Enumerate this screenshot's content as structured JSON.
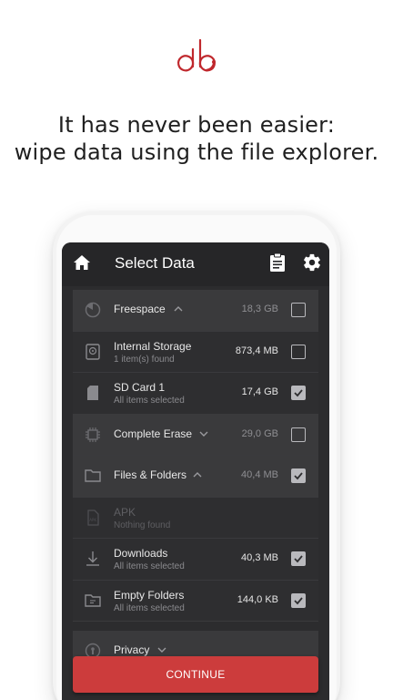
{
  "headline": {
    "line1": "It has never been easier:",
    "line2": "wipe data using the file explorer."
  },
  "colors": {
    "brand": "#c0282d",
    "button": "#cc3c3c",
    "screen": "#2c2c2e"
  },
  "appbar": {
    "title": "Select Data",
    "icons": [
      "home-icon",
      "clipboard-icon",
      "gear-icon"
    ]
  },
  "rows": [
    {
      "kind": "group",
      "icon": "pie-chart-icon",
      "name": "Freespace",
      "chevron": "up",
      "size": "18,3 GB",
      "checked": false
    },
    {
      "kind": "item",
      "icon": "internal-storage-icon",
      "name": "Internal Storage",
      "sub": "1 item(s) found",
      "size": "873,4 MB",
      "checked": false
    },
    {
      "kind": "item",
      "icon": "sd-card-icon",
      "name": "SD Card 1",
      "sub": "All items selected",
      "size": "17,4 GB",
      "checked": true
    },
    {
      "kind": "group",
      "icon": "chip-icon",
      "name": "Complete Erase",
      "chevron": "down",
      "size": "29,0 GB",
      "checked": false
    },
    {
      "kind": "group",
      "icon": "folder-icon",
      "name": "Files & Folders",
      "chevron": "up",
      "size": "40,4 MB",
      "checked": true
    },
    {
      "kind": "item",
      "icon": "apk-file-icon",
      "name": "APK",
      "sub": "Nothing found",
      "size": "",
      "checked": null,
      "disabled": true
    },
    {
      "kind": "item",
      "icon": "download-icon",
      "name": "Downloads",
      "sub": "All items selected",
      "size": "40,3 MB",
      "checked": true
    },
    {
      "kind": "item",
      "icon": "empty-folder-icon",
      "name": "Empty Folders",
      "sub": "All items selected",
      "size": "144,0 KB",
      "checked": true
    },
    {
      "kind": "group",
      "icon": "privacy-icon",
      "name": "Privacy",
      "chevron": "down",
      "size": "",
      "checked": null
    }
  ],
  "continue_label": "CONTINUE"
}
